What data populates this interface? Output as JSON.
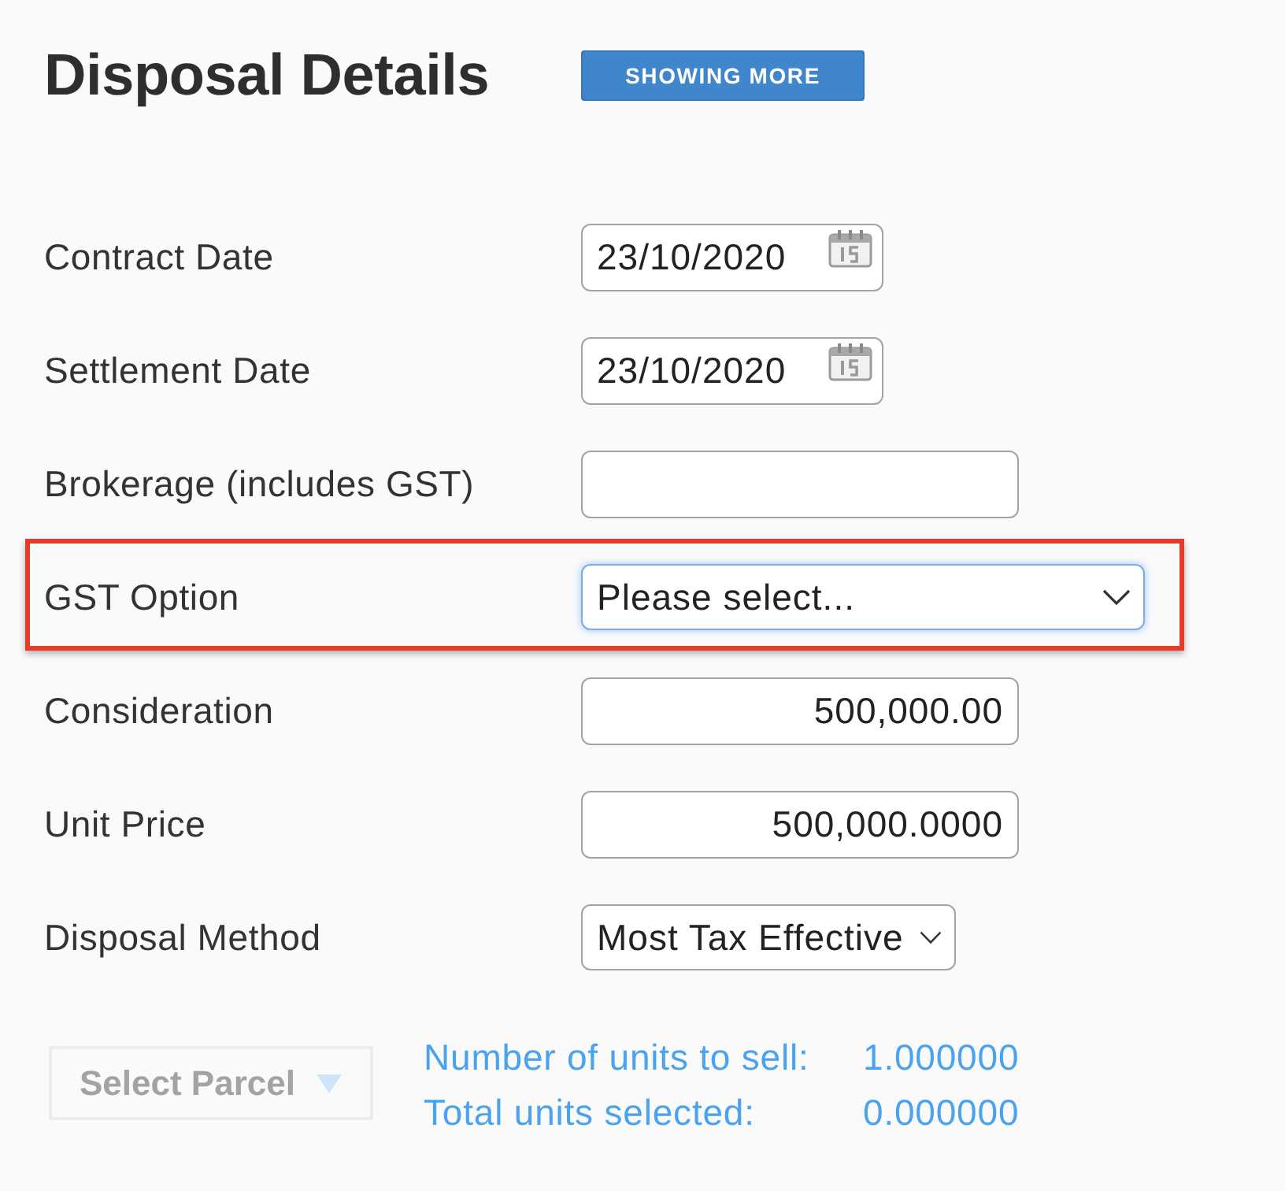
{
  "header": {
    "title": "Disposal Details",
    "toggle_button": "SHOWING MORE"
  },
  "fields": [
    {
      "label": "Contract Date",
      "kind": "date",
      "value": "23/10/2020",
      "focused": false,
      "highlighted": false
    },
    {
      "label": "Settlement Date",
      "kind": "date",
      "value": "23/10/2020",
      "focused": false,
      "highlighted": false
    },
    {
      "label": "Brokerage (includes GST)",
      "kind": "text",
      "focused": false,
      "highlighted": false
    },
    {
      "label": "GST Option",
      "kind": "select",
      "value": "Please select...",
      "focused": true,
      "highlighted": true
    },
    {
      "label": "Consideration",
      "kind": "number",
      "value": "500,000.00",
      "focused": false,
      "highlighted": false
    },
    {
      "label": "Unit Price",
      "kind": "number",
      "value": "500,000.0000",
      "focused": false,
      "highlighted": false
    },
    {
      "label": "Disposal Method",
      "kind": "select",
      "value": "Most Tax Effective",
      "focused": false,
      "highlighted": false
    }
  ],
  "parcel": {
    "button": "Select Parcel",
    "disabled": true,
    "stats": [
      {
        "label": "Number of units to sell:",
        "value": "1.000000"
      },
      {
        "label": "Total units selected:",
        "value": "0.000000"
      }
    ]
  }
}
